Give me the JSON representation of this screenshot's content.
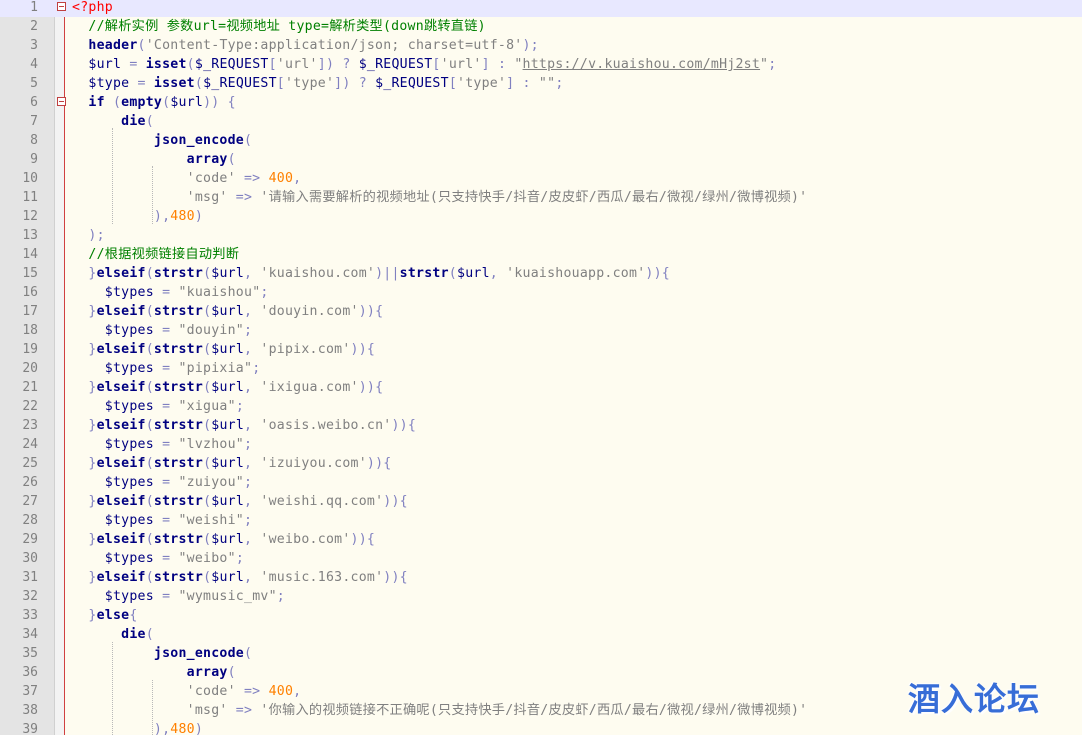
{
  "editor": {
    "current_line": 1,
    "watermark": "酒入论坛",
    "lines": [
      {
        "n": "1",
        "fold": true,
        "tokens": [
          [
            "tag",
            "<?php"
          ]
        ]
      },
      {
        "n": "2",
        "tokens": [
          [
            "cmt",
            "  //解析实例 参数url=视频地址 type=解析类型(down跳转直链)"
          ]
        ]
      },
      {
        "n": "3",
        "tokens": [
          [
            "kw",
            "  header"
          ],
          [
            "op",
            "("
          ],
          [
            "str",
            "'Content-Type:application/json; charset=utf-8'"
          ],
          [
            "op",
            ");"
          ]
        ]
      },
      {
        "n": "4",
        "tokens": [
          [
            "var",
            "  $url "
          ],
          [
            "op",
            "= "
          ],
          [
            "kw",
            "isset"
          ],
          [
            "op",
            "("
          ],
          [
            "var",
            "$_REQUEST"
          ],
          [
            "op",
            "["
          ],
          [
            "str",
            "'url'"
          ],
          [
            "op",
            "]) ? "
          ],
          [
            "var",
            "$_REQUEST"
          ],
          [
            "op",
            "["
          ],
          [
            "str",
            "'url'"
          ],
          [
            "op",
            "] : "
          ],
          [
            "str",
            "\""
          ],
          [
            "url",
            "https://v.kuaishou.com/mHj2st"
          ],
          [
            "str",
            "\""
          ],
          [
            "op",
            ";"
          ]
        ]
      },
      {
        "n": "5",
        "tokens": [
          [
            "var",
            "  $type "
          ],
          [
            "op",
            "= "
          ],
          [
            "kw",
            "isset"
          ],
          [
            "op",
            "("
          ],
          [
            "var",
            "$_REQUEST"
          ],
          [
            "op",
            "["
          ],
          [
            "str",
            "'type'"
          ],
          [
            "op",
            "]) ? "
          ],
          [
            "var",
            "$_REQUEST"
          ],
          [
            "op",
            "["
          ],
          [
            "str",
            "'type'"
          ],
          [
            "op",
            "] : "
          ],
          [
            "str",
            "\"\""
          ],
          [
            "op",
            ";"
          ]
        ]
      },
      {
        "n": "6",
        "fold": true,
        "tokens": [
          [
            "kw",
            "  if "
          ],
          [
            "op",
            "("
          ],
          [
            "kw",
            "empty"
          ],
          [
            "op",
            "("
          ],
          [
            "var",
            "$url"
          ],
          [
            "op",
            ")) {"
          ]
        ]
      },
      {
        "n": "7",
        "tokens": [
          [
            "kw",
            "      die"
          ],
          [
            "op",
            "("
          ]
        ]
      },
      {
        "n": "8",
        "tokens": [
          [
            "kw",
            "          json_encode"
          ],
          [
            "op",
            "("
          ]
        ]
      },
      {
        "n": "9",
        "tokens": [
          [
            "kw",
            "              array"
          ],
          [
            "op",
            "("
          ]
        ]
      },
      {
        "n": "10",
        "tokens": [
          [
            "str",
            "              'code'"
          ],
          [
            "op",
            " => "
          ],
          [
            "num",
            "400"
          ],
          [
            "op",
            ","
          ]
        ]
      },
      {
        "n": "11",
        "tokens": [
          [
            "str",
            "              'msg'"
          ],
          [
            "op",
            " => "
          ],
          [
            "str",
            "'请输入需要解析的视频地址(只支持快手/抖音/皮皮虾/西瓜/最右/微视/绿州/微博视频)'"
          ]
        ]
      },
      {
        "n": "12",
        "tokens": [
          [
            "op",
            "          ),"
          ],
          [
            "num",
            "480"
          ],
          [
            "op",
            ")"
          ]
        ]
      },
      {
        "n": "13",
        "tokens": [
          [
            "op",
            "  );"
          ]
        ]
      },
      {
        "n": "14",
        "tokens": [
          [
            "cmt",
            "  //根据视频链接自动判断"
          ]
        ]
      },
      {
        "n": "15",
        "tokens": [
          [
            "op",
            "  }"
          ],
          [
            "kw",
            "elseif"
          ],
          [
            "op",
            "("
          ],
          [
            "kw",
            "strstr"
          ],
          [
            "op",
            "("
          ],
          [
            "var",
            "$url"
          ],
          [
            "op",
            ", "
          ],
          [
            "str",
            "'kuaishou.com'"
          ],
          [
            "op",
            ")||"
          ],
          [
            "kw",
            "strstr"
          ],
          [
            "op",
            "("
          ],
          [
            "var",
            "$url"
          ],
          [
            "op",
            ", "
          ],
          [
            "str",
            "'kuaishouapp.com'"
          ],
          [
            "op",
            "))"
          ],
          [
            "op",
            "{"
          ]
        ]
      },
      {
        "n": "16",
        "tokens": [
          [
            "var",
            "    $types "
          ],
          [
            "op",
            "= "
          ],
          [
            "str",
            "\"kuaishou\""
          ],
          [
            "op",
            ";"
          ]
        ]
      },
      {
        "n": "17",
        "tokens": [
          [
            "op",
            "  }"
          ],
          [
            "kw",
            "elseif"
          ],
          [
            "op",
            "("
          ],
          [
            "kw",
            "strstr"
          ],
          [
            "op",
            "("
          ],
          [
            "var",
            "$url"
          ],
          [
            "op",
            ", "
          ],
          [
            "str",
            "'douyin.com'"
          ],
          [
            "op",
            "))"
          ],
          [
            "op",
            "{"
          ]
        ]
      },
      {
        "n": "18",
        "tokens": [
          [
            "var",
            "    $types "
          ],
          [
            "op",
            "= "
          ],
          [
            "str",
            "\"douyin\""
          ],
          [
            "op",
            ";"
          ]
        ]
      },
      {
        "n": "19",
        "tokens": [
          [
            "op",
            "  }"
          ],
          [
            "kw",
            "elseif"
          ],
          [
            "op",
            "("
          ],
          [
            "kw",
            "strstr"
          ],
          [
            "op",
            "("
          ],
          [
            "var",
            "$url"
          ],
          [
            "op",
            ", "
          ],
          [
            "str",
            "'pipix.com'"
          ],
          [
            "op",
            "))"
          ],
          [
            "op",
            "{"
          ]
        ]
      },
      {
        "n": "20",
        "tokens": [
          [
            "var",
            "    $types "
          ],
          [
            "op",
            "= "
          ],
          [
            "str",
            "\"pipixia\""
          ],
          [
            "op",
            ";"
          ]
        ]
      },
      {
        "n": "21",
        "tokens": [
          [
            "op",
            "  }"
          ],
          [
            "kw",
            "elseif"
          ],
          [
            "op",
            "("
          ],
          [
            "kw",
            "strstr"
          ],
          [
            "op",
            "("
          ],
          [
            "var",
            "$url"
          ],
          [
            "op",
            ", "
          ],
          [
            "str",
            "'ixigua.com'"
          ],
          [
            "op",
            "))"
          ],
          [
            "op",
            "{"
          ]
        ]
      },
      {
        "n": "22",
        "tokens": [
          [
            "var",
            "    $types "
          ],
          [
            "op",
            "= "
          ],
          [
            "str",
            "\"xigua\""
          ],
          [
            "op",
            ";"
          ]
        ]
      },
      {
        "n": "23",
        "tokens": [
          [
            "op",
            "  }"
          ],
          [
            "kw",
            "elseif"
          ],
          [
            "op",
            "("
          ],
          [
            "kw",
            "strstr"
          ],
          [
            "op",
            "("
          ],
          [
            "var",
            "$url"
          ],
          [
            "op",
            ", "
          ],
          [
            "str",
            "'oasis.weibo.cn'"
          ],
          [
            "op",
            "))"
          ],
          [
            "op",
            "{"
          ]
        ]
      },
      {
        "n": "24",
        "tokens": [
          [
            "var",
            "    $types "
          ],
          [
            "op",
            "= "
          ],
          [
            "str",
            "\"lvzhou\""
          ],
          [
            "op",
            ";"
          ]
        ]
      },
      {
        "n": "25",
        "tokens": [
          [
            "op",
            "  }"
          ],
          [
            "kw",
            "elseif"
          ],
          [
            "op",
            "("
          ],
          [
            "kw",
            "strstr"
          ],
          [
            "op",
            "("
          ],
          [
            "var",
            "$url"
          ],
          [
            "op",
            ", "
          ],
          [
            "str",
            "'izuiyou.com'"
          ],
          [
            "op",
            "))"
          ],
          [
            "op",
            "{"
          ]
        ]
      },
      {
        "n": "26",
        "tokens": [
          [
            "var",
            "    $types "
          ],
          [
            "op",
            "= "
          ],
          [
            "str",
            "\"zuiyou\""
          ],
          [
            "op",
            ";"
          ]
        ]
      },
      {
        "n": "27",
        "tokens": [
          [
            "op",
            "  }"
          ],
          [
            "kw",
            "elseif"
          ],
          [
            "op",
            "("
          ],
          [
            "kw",
            "strstr"
          ],
          [
            "op",
            "("
          ],
          [
            "var",
            "$url"
          ],
          [
            "op",
            ", "
          ],
          [
            "str",
            "'weishi.qq.com'"
          ],
          [
            "op",
            "))"
          ],
          [
            "op",
            "{"
          ]
        ]
      },
      {
        "n": "28",
        "tokens": [
          [
            "var",
            "    $types "
          ],
          [
            "op",
            "= "
          ],
          [
            "str",
            "\"weishi\""
          ],
          [
            "op",
            ";"
          ]
        ]
      },
      {
        "n": "29",
        "tokens": [
          [
            "op",
            "  }"
          ],
          [
            "kw",
            "elseif"
          ],
          [
            "op",
            "("
          ],
          [
            "kw",
            "strstr"
          ],
          [
            "op",
            "("
          ],
          [
            "var",
            "$url"
          ],
          [
            "op",
            ", "
          ],
          [
            "str",
            "'weibo.com'"
          ],
          [
            "op",
            "))"
          ],
          [
            "op",
            "{"
          ]
        ]
      },
      {
        "n": "30",
        "tokens": [
          [
            "var",
            "    $types "
          ],
          [
            "op",
            "= "
          ],
          [
            "str",
            "\"weibo\""
          ],
          [
            "op",
            ";"
          ]
        ]
      },
      {
        "n": "31",
        "tokens": [
          [
            "op",
            "  }"
          ],
          [
            "kw",
            "elseif"
          ],
          [
            "op",
            "("
          ],
          [
            "kw",
            "strstr"
          ],
          [
            "op",
            "("
          ],
          [
            "var",
            "$url"
          ],
          [
            "op",
            ", "
          ],
          [
            "str",
            "'music.163.com'"
          ],
          [
            "op",
            "))"
          ],
          [
            "op",
            "{"
          ]
        ]
      },
      {
        "n": "32",
        "tokens": [
          [
            "var",
            "    $types "
          ],
          [
            "op",
            "= "
          ],
          [
            "str",
            "\"wymusic_mv\""
          ],
          [
            "op",
            ";"
          ]
        ]
      },
      {
        "n": "33",
        "tokens": [
          [
            "op",
            "  }"
          ],
          [
            "kw",
            "else"
          ],
          [
            "op",
            "{"
          ]
        ]
      },
      {
        "n": "34",
        "tokens": [
          [
            "kw",
            "      die"
          ],
          [
            "op",
            "("
          ]
        ]
      },
      {
        "n": "35",
        "tokens": [
          [
            "kw",
            "          json_encode"
          ],
          [
            "op",
            "("
          ]
        ]
      },
      {
        "n": "36",
        "tokens": [
          [
            "kw",
            "              array"
          ],
          [
            "op",
            "("
          ]
        ]
      },
      {
        "n": "37",
        "tokens": [
          [
            "str",
            "              'code'"
          ],
          [
            "op",
            " => "
          ],
          [
            "num",
            "400"
          ],
          [
            "op",
            ","
          ]
        ]
      },
      {
        "n": "38",
        "tokens": [
          [
            "str",
            "              'msg'"
          ],
          [
            "op",
            " => "
          ],
          [
            "str",
            "'你输入的视频链接不正确呢(只支持快手/抖音/皮皮虾/西瓜/最右/微视/绿州/微博视频)'"
          ]
        ]
      },
      {
        "n": "39",
        "tokens": [
          [
            "op",
            "          ),"
          ],
          [
            "num",
            "480"
          ],
          [
            "op",
            ")"
          ]
        ]
      }
    ]
  },
  "colors": {
    "background": "#fefcf0",
    "keyword": "#000080",
    "string": "#808080",
    "number": "#ff8000",
    "comment": "#008000",
    "php_tag": "#ff0000",
    "watermark": "#2d66d6"
  }
}
